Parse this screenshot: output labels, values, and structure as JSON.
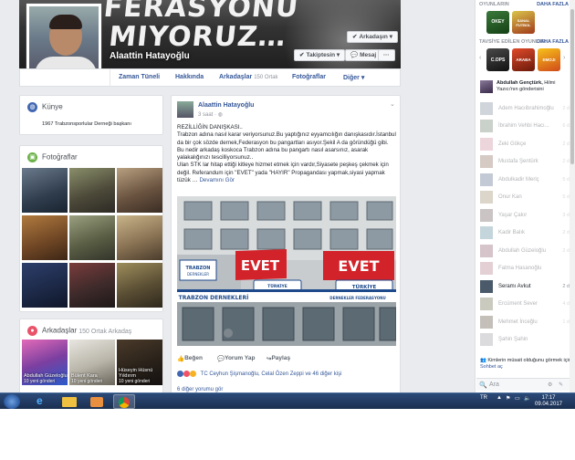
{
  "profile": {
    "cover_text_line1": "…FERASYONU",
    "cover_text_line2": "MIYORUZ…",
    "name": "Alaattin Hatayoğlu",
    "buttons": {
      "friends": "Arkadaşın",
      "following": "Takiptesin",
      "message": "Mesaj",
      "more": "···"
    }
  },
  "nav": {
    "tabs": [
      {
        "label": "Zaman Tüneli"
      },
      {
        "label": "Hakkında"
      },
      {
        "label": "Arkadaşlar",
        "count": "150 Ortak"
      },
      {
        "label": "Fotoğraflar"
      },
      {
        "label": "Diğer",
        "chevron": "▾"
      }
    ]
  },
  "intro": {
    "title": "Künye",
    "item": "1967 Trabzonsporlular Derneği başkanı"
  },
  "photos": {
    "title": "Fotoğraflar"
  },
  "friends": {
    "title": "Arkadaşlar",
    "subtitle": "150 Ortak Arkadaş",
    "items": [
      {
        "name": "Abdullah Güzeloğlu",
        "sub": "10 yeni gönderi"
      },
      {
        "name": "Bülent Kara",
        "sub": "10 yeni gönderi"
      },
      {
        "name": "Hüseyin Hüsnü Yıldırım",
        "sub": "10 yeni gönderi"
      }
    ]
  },
  "post": {
    "author": "Alaattin Hatayoğlu",
    "time": "3 saat",
    "paragraphs": [
      "REZİLLİĞİN DANIŞKASI..",
      "Trabzon adına nasıl karar veriyorsunuz.Bu yaptığınız eyyamcılığın danışkasıdır.İstanbul da bir çok sözde dernek,Federasyon bu pangartları asıyor.Şekil A da göründüğü gibi. Bu nedir arkadaş koskoca Trabzon adına bu pangartı nasıl asarsınız, asarak yalakalığınızı tescilliyorsunuz..",
      "Ulan STK lar hitap ettiği kitleye hizmet etmek için vardır,Siyasete peşkeş çekmek için değil. Referandum için \"EVET\" yada \"HAYIR\" Propagandası yapmak,siyasi yapmak tüzük …"
    ],
    "see_more": "Devamını Gör",
    "image_banners": {
      "evet1": "EVET",
      "evet2": "EVET",
      "brand1": "TÜRKİYE YENİLENSİN",
      "sign": "TRABZON DERNEKLERİ",
      "sign2": "DERNEKLER FEDERASYONU GENEL MERKEZİ"
    },
    "actions": {
      "like": "Beğen",
      "comment": "Yorum Yap",
      "share": "Paylaş"
    },
    "reactions": "TC Ceyhun Şişmanoğlu, Celal Özen Zeppi ve 46 diğer kişi",
    "cut_text": "6 diğer yorumu gör"
  },
  "right": {
    "games_header": "OYUNLARIN",
    "games_more": "DAHA FAZLA",
    "games": [
      {
        "name": "OKEY"
      },
      {
        "name": "SANAL FUTBOL"
      }
    ],
    "suggested_header": "TAVSİYE EDİLEN OYUNLAR",
    "suggested_more": "DAHA FAZLA",
    "suggested": [
      {
        "name": "C.OPS"
      },
      {
        "name": "ARABA"
      },
      {
        "name": "EMOJI"
      }
    ],
    "notification": {
      "name": "Abdullah Gençtürk,",
      "text": "Hilmi Yazıcı'nın gönderisini"
    },
    "contacts": [
      {
        "name": "Adem Hacıibrahimoğlu",
        "time": "2 d"
      },
      {
        "name": "İbrahim Vehbi Hacı...",
        "time": "6 d"
      },
      {
        "name": "Zeki Gökçe",
        "time": "2 d"
      },
      {
        "name": "Mustafa Şentürk",
        "time": "2 d"
      },
      {
        "name": "Abdulkadir Meriç",
        "time": "5 d"
      },
      {
        "name": "Onur Kan",
        "time": "5 d"
      },
      {
        "name": "Yaşar Çakır",
        "time": "3 d"
      },
      {
        "name": "Kadir Balık",
        "time": "2 d"
      },
      {
        "name": "Abdullah Güzeloğlu",
        "time": "2 d"
      },
      {
        "name": "Fatma Hasanoğlu",
        "time": ""
      },
      {
        "name": "Seramı Avkut",
        "time": "2 d"
      },
      {
        "name": "Ercüment Sever",
        "time": "4 d"
      },
      {
        "name": "Mehmet İnceğlu",
        "time": "1 d"
      },
      {
        "name": "Şahin Şahin",
        "time": ""
      }
    ],
    "chat_hint": "Kimlerin müsait olduğunu görmek için",
    "chat_link": "Sohbet aç",
    "search_placeholder": "Ara"
  },
  "taskbar": {
    "lang": "TR",
    "time": "17:17",
    "date": "09.04.2017"
  },
  "colors": {
    "fb_blue": "#365899",
    "bg": "#e9ebee",
    "evet_red": "#d3232a"
  }
}
